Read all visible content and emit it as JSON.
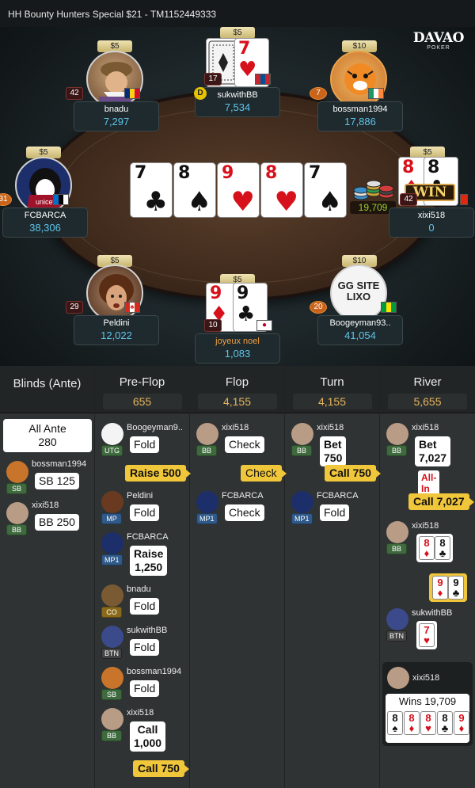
{
  "title": "HH  Bounty Hunters Special $21    - TM1152449333",
  "logo": {
    "line1": "DAVAO",
    "line2": "POKER"
  },
  "seats": [
    {
      "name": "bnadu",
      "stack": "7,297",
      "bet": "$5",
      "level": "42"
    },
    {
      "name": "sukwithBB",
      "stack": "7,534",
      "bet": "$5",
      "level": "17"
    },
    {
      "name": "bossman1994",
      "stack": "17,886",
      "bet": "$10",
      "level": "7"
    },
    {
      "name": "FCBARCA",
      "stack": "38,306",
      "bet": "$5",
      "level": "31"
    },
    {
      "name": "xixi518",
      "stack": "0",
      "bet": "$5",
      "level": "42"
    },
    {
      "name": "Peldini",
      "stack": "12,022",
      "bet": "$5",
      "level": "29"
    },
    {
      "name": "joyeux noel",
      "stack": "1,083",
      "bet": "$5",
      "level": "10"
    },
    {
      "name": "Boogeyman93..",
      "stack": "41,054",
      "bet": "$10",
      "level": "20"
    }
  ],
  "avatar_texts": {
    "unicef": "unicef",
    "gg": "GG SITE LIXO",
    "win": "WIN"
  },
  "dealer_label": "D",
  "board": [
    {
      "rank": "7",
      "suit": "♣",
      "color": "#111111"
    },
    {
      "rank": "8",
      "suit": "♠",
      "color": "#111111"
    },
    {
      "rank": "9",
      "suit": "♥",
      "color": "#d7111b"
    },
    {
      "rank": "8",
      "suit": "♥",
      "color": "#d7111b"
    },
    {
      "rank": "7",
      "suit": "♠",
      "color": "#111111"
    }
  ],
  "pot": "19,709",
  "hands": {
    "sukwithBB": [
      {
        "rank": "7",
        "suit": "♥"
      }
    ],
    "xixi518": [
      {
        "rank": "8",
        "suit": "♦"
      },
      {
        "rank": "8",
        "suit": "♣"
      }
    ],
    "joyeux": [
      {
        "rank": "9",
        "suit": "♦"
      },
      {
        "rank": "9",
        "suit": "♣"
      }
    ]
  },
  "streets": [
    {
      "name": "Blinds (Ante)",
      "amount": ""
    },
    {
      "name": "Pre-Flop",
      "amount": "655"
    },
    {
      "name": "Flop",
      "amount": "4,155"
    },
    {
      "name": "Turn",
      "amount": "4,155"
    },
    {
      "name": "River",
      "amount": "5,655"
    }
  ],
  "blinds": {
    "ante_title": "All Ante",
    "ante_amount": "280",
    "sb_player": "bossman1994",
    "sb_pos": "SB",
    "sb_action": "SB 125",
    "bb_player": "xixi518",
    "bb_pos": "BB",
    "bb_action": "BB 250"
  },
  "preflop": [
    {
      "player": "Boogeyman9..",
      "pos": "UTG",
      "action": "Fold"
    },
    {
      "raise_bubble": "Raise 500"
    },
    {
      "player": "Peldini",
      "pos": "MP",
      "action": "Fold"
    },
    {
      "player": "FCBARCA",
      "pos": "MP1",
      "action": "Raise\n1,250"
    },
    {
      "player": "bnadu",
      "pos": "CO",
      "action": "Fold"
    },
    {
      "player": "sukwithBB",
      "pos": "BTN",
      "action": "Fold"
    },
    {
      "player": "bossman1994",
      "pos": "SB",
      "action": "Fold"
    },
    {
      "player": "xixi518",
      "pos": "BB",
      "action": "Call\n1,000"
    },
    {
      "call_bubble": "Call 750"
    }
  ],
  "flop": [
    {
      "player": "xixi518",
      "pos": "BB",
      "action": "Check"
    },
    {
      "bubble": "Check"
    },
    {
      "player": "FCBARCA",
      "pos": "MP1",
      "action": "Check"
    }
  ],
  "turn": [
    {
      "player": "xixi518",
      "pos": "BB",
      "action": "Bet 750"
    },
    {
      "bubble": "Call 750"
    },
    {
      "player": "FCBARCA",
      "pos": "MP1",
      "action": "Fold"
    }
  ],
  "river": {
    "player": "xixi518",
    "pos": "BB",
    "action": "Bet\n7,027",
    "allin": "All-In",
    "call": "Call 7,027",
    "show_player": "xixi518",
    "show_pos": "BB",
    "btn_player": "sukwithBB",
    "btn_pos": "BTN",
    "winner": "xixi518",
    "wins": "Wins 19,709",
    "win_hand": [
      {
        "rank": "8",
        "suit": "♠",
        "color": "#111111"
      },
      {
        "rank": "8",
        "suit": "♦",
        "color": "#d7111b"
      },
      {
        "rank": "8",
        "suit": "♥",
        "color": "#d7111b"
      },
      {
        "rank": "8",
        "suit": "♣",
        "color": "#111111"
      },
      {
        "rank": "9",
        "suit": "♦",
        "color": "#d7111b"
      }
    ]
  }
}
